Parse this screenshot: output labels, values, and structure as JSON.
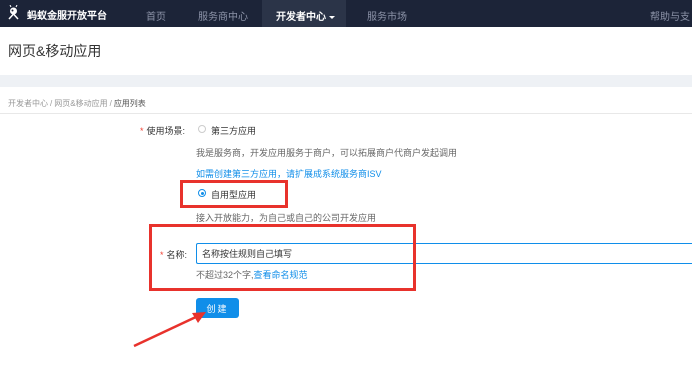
{
  "topnav": {
    "brand": "蚂蚁金服开放平台",
    "items": [
      "首页",
      "服务商中心",
      "开发者中心",
      "服务市场"
    ],
    "active_index": 2,
    "right_link": "帮助与支"
  },
  "page_title": "网页&移动应用",
  "breadcrumb": {
    "items": [
      "开发者中心",
      "网页&移动应用",
      "应用列表"
    ],
    "separator": "/"
  },
  "form": {
    "scene": {
      "label": "使用场景:",
      "options": [
        {
          "label": "第三方应用",
          "checked": false
        },
        {
          "label": "自用型应用",
          "checked": true
        }
      ],
      "third_party_desc": "我是服务商，开发应用服务于商户，可以拓展商户代商户发起调用",
      "third_party_link": "如需创建第三方应用，请扩展成系统服务商ISV",
      "self_use_desc": "接入开放能力，为自己或自己的公司开发应用"
    },
    "name": {
      "label": "名称:",
      "value": "名称按住规则自己填写",
      "hint": "不超过32个字,",
      "hint_link": "查看命名规范"
    },
    "create_label": "创建"
  },
  "colors": {
    "nav_bg": "#1c2438",
    "accent": "#108ee9",
    "required": "#f04134",
    "annotation": "#e8322c"
  }
}
